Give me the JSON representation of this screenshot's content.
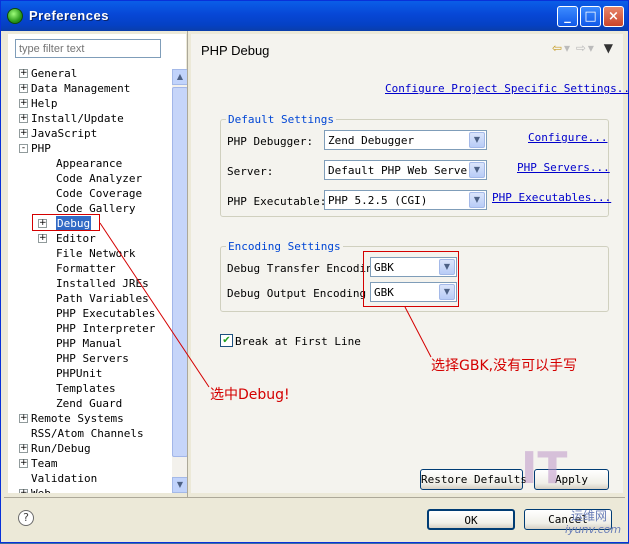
{
  "window": {
    "title": "Preferences",
    "controls": [
      "_",
      "□",
      "×"
    ]
  },
  "left": {
    "filter_placeholder": "type filter text",
    "tree": [
      {
        "label": "General",
        "level": 0,
        "expander": "+"
      },
      {
        "label": "Data Management",
        "level": 0,
        "expander": "+"
      },
      {
        "label": "Help",
        "level": 0,
        "expander": "+"
      },
      {
        "label": "Install/Update",
        "level": 0,
        "expander": "+"
      },
      {
        "label": "JavaScript",
        "level": 0,
        "expander": "+"
      },
      {
        "label": "PHP",
        "level": 0,
        "expander": "-"
      },
      {
        "label": "Appearance",
        "level": 1,
        "expander": ""
      },
      {
        "label": "Code Analyzer",
        "level": 1,
        "expander": ""
      },
      {
        "label": "Code Coverage",
        "level": 1,
        "expander": ""
      },
      {
        "label": "Code Gallery",
        "level": 1,
        "expander": ""
      },
      {
        "label": "Debug",
        "level": 1,
        "expander": "+",
        "selected": true
      },
      {
        "label": "Editor",
        "level": 1,
        "expander": "+"
      },
      {
        "label": "File Network",
        "level": 1,
        "expander": ""
      },
      {
        "label": "Formatter",
        "level": 1,
        "expander": ""
      },
      {
        "label": "Installed JREs",
        "level": 1,
        "expander": ""
      },
      {
        "label": "Path Variables",
        "level": 1,
        "expander": ""
      },
      {
        "label": "PHP Executables",
        "level": 1,
        "expander": ""
      },
      {
        "label": "PHP Interpreter",
        "level": 1,
        "expander": ""
      },
      {
        "label": "PHP Manual",
        "level": 1,
        "expander": ""
      },
      {
        "label": "PHP Servers",
        "level": 1,
        "expander": ""
      },
      {
        "label": "PHPUnit",
        "level": 1,
        "expander": ""
      },
      {
        "label": "Templates",
        "level": 1,
        "expander": ""
      },
      {
        "label": "Zend Guard",
        "level": 1,
        "expander": ""
      },
      {
        "label": "Remote Systems",
        "level": 0,
        "expander": "+"
      },
      {
        "label": "RSS/Atom Channels",
        "level": 0,
        "expander": ""
      },
      {
        "label": "Run/Debug",
        "level": 0,
        "expander": "+"
      },
      {
        "label": "Team",
        "level": 0,
        "expander": "+"
      },
      {
        "label": "Validation",
        "level": 0,
        "expander": ""
      },
      {
        "label": "Web",
        "level": 0,
        "expander": "+"
      }
    ]
  },
  "right": {
    "title": "PHP Debug",
    "nav": {
      "back": "⇦",
      "dropdown": "▾",
      "forward": "⇨",
      "menu": "▼"
    },
    "project_link": "Configure Project Specific Settings...",
    "default_settings": {
      "legend": "Default Settings",
      "rows": [
        {
          "label": "PHP Debugger:",
          "value": "Zend Debugger",
          "link": "Configure..."
        },
        {
          "label": "Server:",
          "value": "Default PHP Web Server",
          "link": "PHP Servers..."
        },
        {
          "label": "PHP Executable:",
          "value": "PHP 5.2.5 (CGI)",
          "link": "PHP Executables..."
        }
      ]
    },
    "encoding_settings": {
      "legend": "Encoding Settings",
      "rows": [
        {
          "label": "Debug Transfer Encoding",
          "value": "GBK"
        },
        {
          "label": "Debug Output Encoding",
          "value": "GBK"
        }
      ]
    },
    "break_first_line": {
      "label": "Break at First Line",
      "checked": true,
      "mark": "✔"
    },
    "restore_defaults": "Restore Defaults",
    "apply": "Apply"
  },
  "bottom": {
    "help": "?",
    "ok": "OK",
    "cancel": "Cancel"
  },
  "annotations": {
    "debug_note": "选中Debug!",
    "gbk_note": "选择GBK,没有可以手写"
  },
  "watermark": {
    "cn": "运维网",
    "en": "iyunv.com"
  },
  "colors": {
    "accent": "#316ac5",
    "annotation": "#d40000",
    "link": "#0000cc",
    "legend": "#0046d5"
  }
}
